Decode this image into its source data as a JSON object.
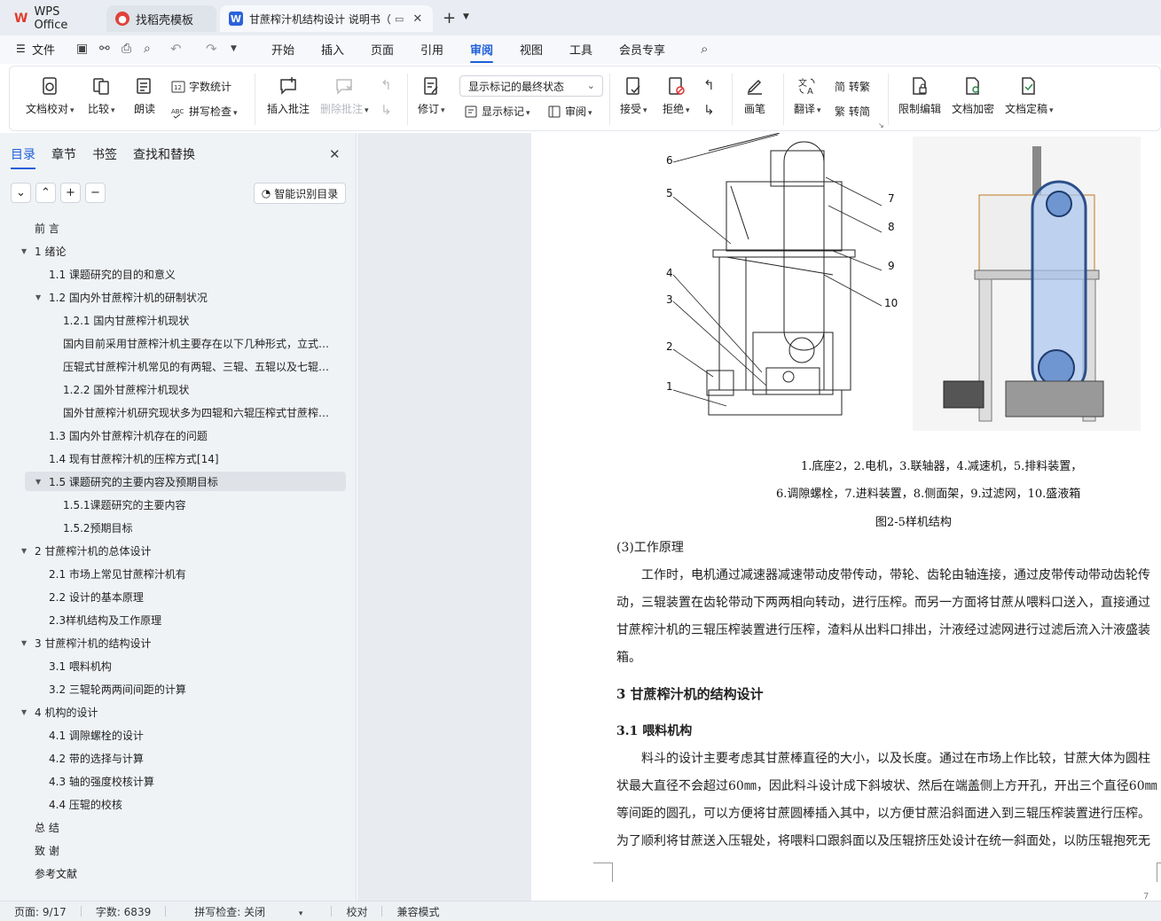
{
  "tabs": [
    {
      "label": "WPS Office",
      "icon": "wps-logo-icon"
    },
    {
      "label": "找稻壳模板",
      "icon": "daoke-logo-icon"
    },
    {
      "label": "甘蔗榨汁机结构设计 说明书（",
      "icon": "word-doc-icon"
    }
  ],
  "menu": {
    "file": "文件",
    "items": [
      "开始",
      "插入",
      "页面",
      "引用",
      "审阅",
      "视图",
      "工具",
      "会员专享"
    ],
    "active": "审阅"
  },
  "ribbon": {
    "proofread": "文档校对",
    "compare": "比较",
    "read": "朗读",
    "word_count": "字数统计",
    "spell_check": "拼写检查",
    "insert_comment": "插入批注",
    "delete_comment": "删除批注",
    "revise": "修订",
    "display_state": "显示标记的最终状态",
    "show_markup": "显示标记",
    "review": "审阅",
    "accept": "接受",
    "reject": "拒绝",
    "pen": "画笔",
    "translate": "翻译",
    "to_traditional": "转繁",
    "to_simplified": "转简",
    "restrict_edit": "限制编辑",
    "encrypt": "文档加密",
    "finalize": "文档定稿"
  },
  "sidebar": {
    "tabs": [
      "目录",
      "章节",
      "书签",
      "查找和替换"
    ],
    "smart_toc": "智能识别目录",
    "toc": [
      {
        "label": "前 言",
        "level": 0,
        "toggle": ""
      },
      {
        "label": "1 绪论",
        "level": 0,
        "toggle": "▼"
      },
      {
        "label": "1.1 课题研究的目的和意义",
        "level": 1,
        "toggle": ""
      },
      {
        "label": "1.2 国内外甘蔗榨汁机的研制状况",
        "level": 1,
        "toggle": "▼"
      },
      {
        "label": "1.2.1 国内甘蔗榨汁机现状",
        "level": 2,
        "toggle": ""
      },
      {
        "label": "国内目前采用甘蔗榨汁机主要存在以下几种形式，立式…",
        "level": 2,
        "toggle": ""
      },
      {
        "label": "压辊式甘蔗榨汁机常见的有两辊、三辊、五辊以及七辊…",
        "level": 2,
        "toggle": ""
      },
      {
        "label": "1.2.2  国外甘蔗榨汁机现状",
        "level": 2,
        "toggle": ""
      },
      {
        "label": "国外甘蔗榨汁机研究现状多为四辊和六辊压榨式甘蔗榨…",
        "level": 2,
        "toggle": ""
      },
      {
        "label": "1.3 国内外甘蔗榨汁机存在的问题",
        "level": 1,
        "toggle": ""
      },
      {
        "label": "1.4 现有甘蔗榨汁机的压榨方式[14]",
        "level": 1,
        "toggle": ""
      },
      {
        "label": "1.5 课题研究的主要内容及预期目标",
        "level": 1,
        "toggle": "▼",
        "selected": true
      },
      {
        "label": "1.5.1课题研究的主要内容",
        "level": 2,
        "toggle": ""
      },
      {
        "label": "1.5.2预期目标",
        "level": 2,
        "toggle": ""
      },
      {
        "label": "2 甘蔗榨汁机的总体设计",
        "level": 0,
        "toggle": "▼"
      },
      {
        "label": "2.1 市场上常见甘蔗榨汁机有",
        "level": 1,
        "toggle": ""
      },
      {
        "label": "2.2 设计的基本原理",
        "level": 1,
        "toggle": ""
      },
      {
        "label": "2.3样机结构及工作原理",
        "level": 1,
        "toggle": ""
      },
      {
        "label": "3 甘蔗榨汁机的结构设计",
        "level": 0,
        "toggle": "▼"
      },
      {
        "label": "3.1 喂料机构",
        "level": 1,
        "toggle": ""
      },
      {
        "label": "3.2 三辊轮两两间间距的计算",
        "level": 1,
        "toggle": ""
      },
      {
        "label": "4 机构的设计",
        "level": 0,
        "toggle": "▼"
      },
      {
        "label": "4.1 调隙螺栓的设计",
        "level": 1,
        "toggle": ""
      },
      {
        "label": "4.2 带的选择与计算",
        "level": 1,
        "toggle": ""
      },
      {
        "label": "4.3 轴的强度校核计算",
        "level": 1,
        "toggle": ""
      },
      {
        "label": "4.4 压辊的校核",
        "level": 1,
        "toggle": ""
      },
      {
        "label": "总 结",
        "level": 0,
        "toggle": ""
      },
      {
        "label": "致 谢",
        "level": 0,
        "toggle": ""
      },
      {
        "label": "参考文献",
        "level": 0,
        "toggle": ""
      }
    ]
  },
  "document": {
    "figure_labels": [
      "6",
      "5",
      "4",
      "3",
      "2",
      "1",
      "7",
      "8",
      "9",
      "10"
    ],
    "caption_line1": "1.底座2，2.电机，3.联轴器，4.减速机，5.排料装置，",
    "caption_line2": "6.调隙螺栓，7.进料装置，8.侧面架，9.过滤网，10.盛液箱",
    "figure_title": "图2-5样机结构",
    "sub_heading": "(3)工作原理",
    "para1_l1": "工作时，电机通过减速器减速带动皮带传动，带轮、齿轮由轴连接，通过皮带传动带动齿轮传",
    "para1_l2": "动，三辊装置在齿轮带动下两两相向转动，进行压榨。而另一方面将甘蔗从喂料口送入，直接通过",
    "para1_l3": "甘蔗榨汁机的三辊压榨装置进行压榨，渣料从出料口排出，汁液经过滤网进行过滤后流入汁液盛装",
    "para1_l4": "箱。",
    "heading3": "3 甘蔗榨汁机的结构设计",
    "heading31": "3.1 喂料机构",
    "para2_l1": "料斗的设计主要考虑其甘蔗棒直径的大小，以及长度。通过在市场上作比较，甘蔗大体为圆柱",
    "para2_l2": "状最大直径不会超过60㎜，因此料斗设计成下斜坡状、然后在端盖侧上方开孔，开出三个直径60㎜",
    "para2_l3": "等间距的圆孔，可以方便将甘蔗圆棒插入其中，以方便甘蔗沿斜面进入到三辊压榨装置进行压榨。",
    "para2_l4": "为了顺利将甘蔗送入压辊处，将喂料口跟斜面以及压辊挤压处设计在统一斜面处，以防压辊抱死无",
    "page_number": "7"
  },
  "status": {
    "page": "页面: 9/17",
    "words": "字数: 6839",
    "spell": "拼写检查: 关闭",
    "proof": "校对",
    "compat": "兼容模式"
  }
}
